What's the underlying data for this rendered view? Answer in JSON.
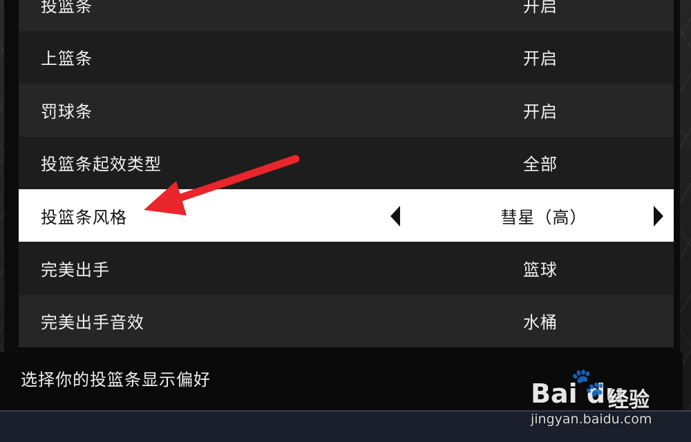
{
  "settings": {
    "rows": [
      {
        "label": "投篮条",
        "value": "开启"
      },
      {
        "label": "上篮条",
        "value": "开启"
      },
      {
        "label": "罚球条",
        "value": "开启"
      },
      {
        "label": "投篮条起效类型",
        "value": "全部"
      },
      {
        "label": "投篮条风格",
        "value": "彗星（高）"
      },
      {
        "label": "完美出手",
        "value": "篮球"
      },
      {
        "label": "完美出手音效",
        "value": "水桶"
      }
    ],
    "selected_index": 4
  },
  "hint": {
    "text": "选择你的投篮条显示偏好"
  },
  "annotation": {
    "arrow_color": "#e8262b"
  },
  "watermark": {
    "logo_text": "Bai du",
    "logo_cn": "经验",
    "url": "jingyan.baidu.com",
    "icon": "paw-icon"
  },
  "colors": {
    "row_dark": "#262626",
    "row_darker": "#1d1d1d",
    "row_selected": "#ffffff",
    "text_light": "#f2f2f2",
    "text_dark": "#111111"
  }
}
